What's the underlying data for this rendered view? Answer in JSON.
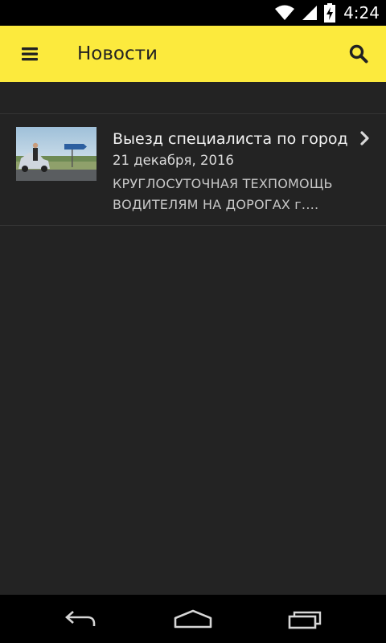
{
  "status_bar": {
    "time": "4:24",
    "icons": [
      "wifi-icon",
      "cell-signal-icon",
      "battery-charging-icon"
    ]
  },
  "app_bar": {
    "title": "Новости",
    "background": "#fcea3d",
    "menu_icon": "hamburger-menu-icon",
    "search_icon": "search-icon"
  },
  "news": {
    "items": [
      {
        "title": "Выезд специалиста по город…",
        "date": "21 декабря, 2016",
        "description": "КРУГЛОСУТОЧНАЯ ТЕХПОМОЩЬ ВОДИТЕЛЯМ НА ДОРОГАХ г.…",
        "thumbnail_icon": "car-roadside-photo"
      }
    ]
  },
  "nav_bar": {
    "icons": [
      "back-icon",
      "home-icon",
      "recents-icon"
    ]
  }
}
